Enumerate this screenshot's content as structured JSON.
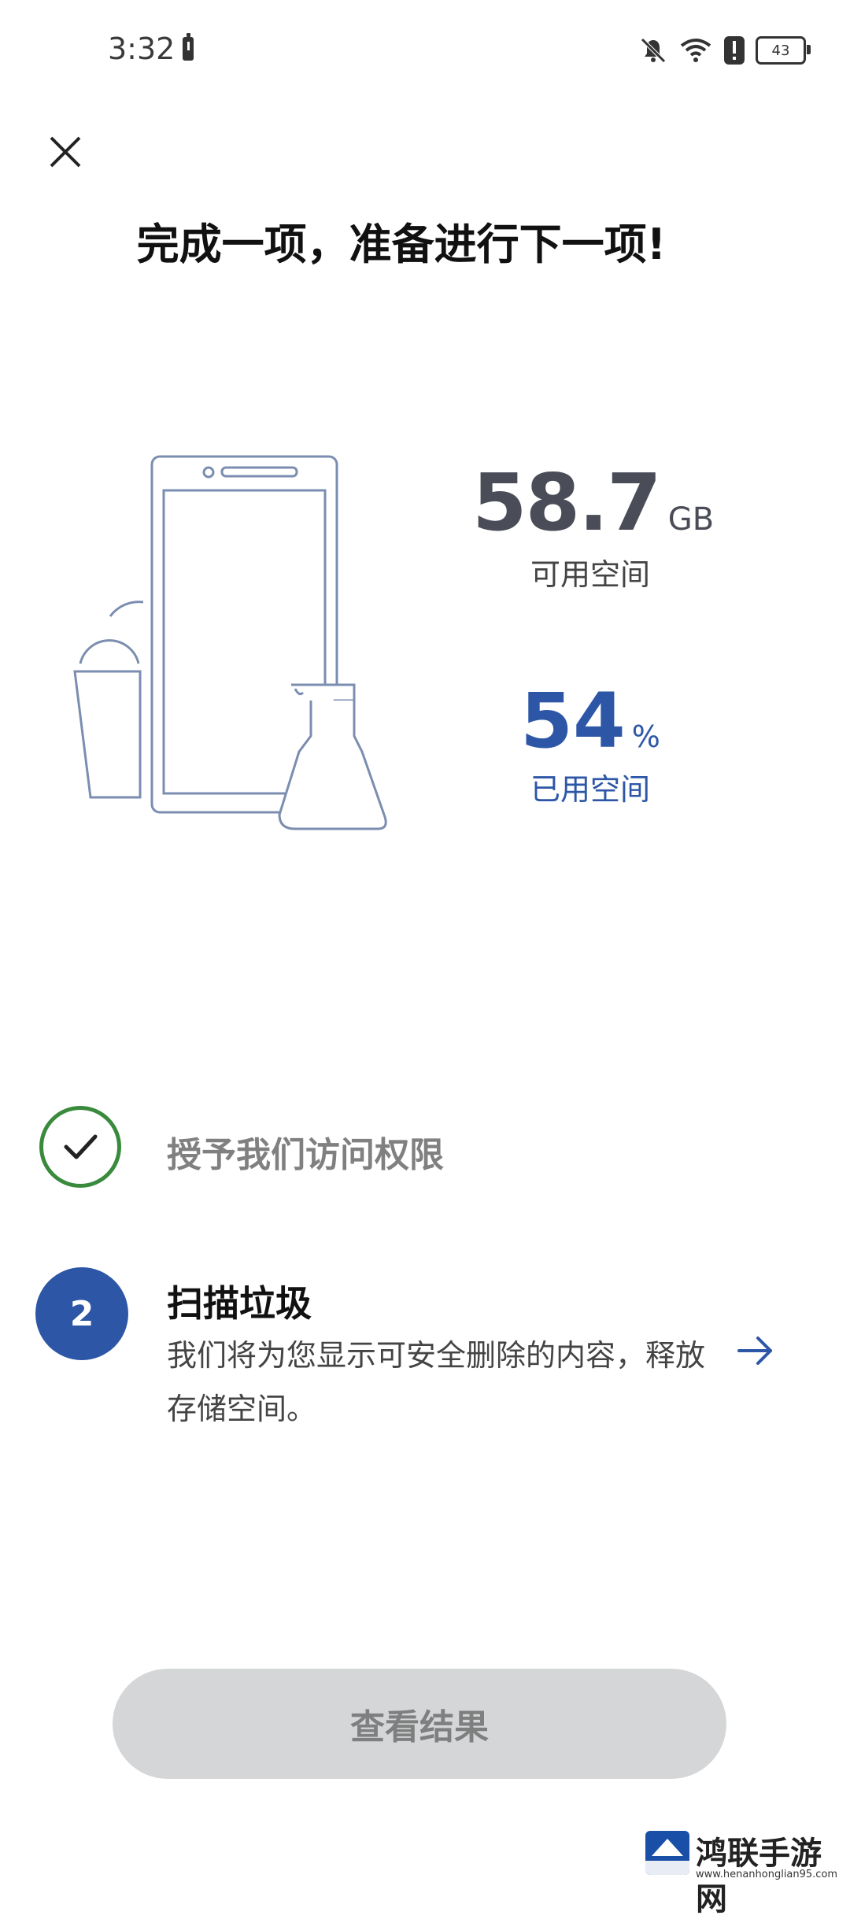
{
  "status_bar": {
    "time": "3:32",
    "battery_level": "43"
  },
  "header": {
    "close_icon": "close-icon"
  },
  "title": "完成一项，准备进行下一项!",
  "storage": {
    "available_value": "58.7",
    "available_unit": "GB",
    "available_label": "可用空间",
    "used_value": "54",
    "used_unit": "%",
    "used_label": "已用空间"
  },
  "steps": [
    {
      "status": "done",
      "label": "授予我们访问权限"
    },
    {
      "number": "2",
      "title": "扫描垃圾",
      "description": "我们将为您显示可安全删除的内容，释放存储空间。"
    }
  ],
  "primary_button": {
    "label": "查看结果"
  },
  "watermark": {
    "text": "鸿联手游网",
    "url": "www.henanhonglian95.com"
  },
  "colors": {
    "accent": "#2d57a6",
    "success": "#3a8a3d",
    "disabled_button": "#d4d6d7"
  }
}
